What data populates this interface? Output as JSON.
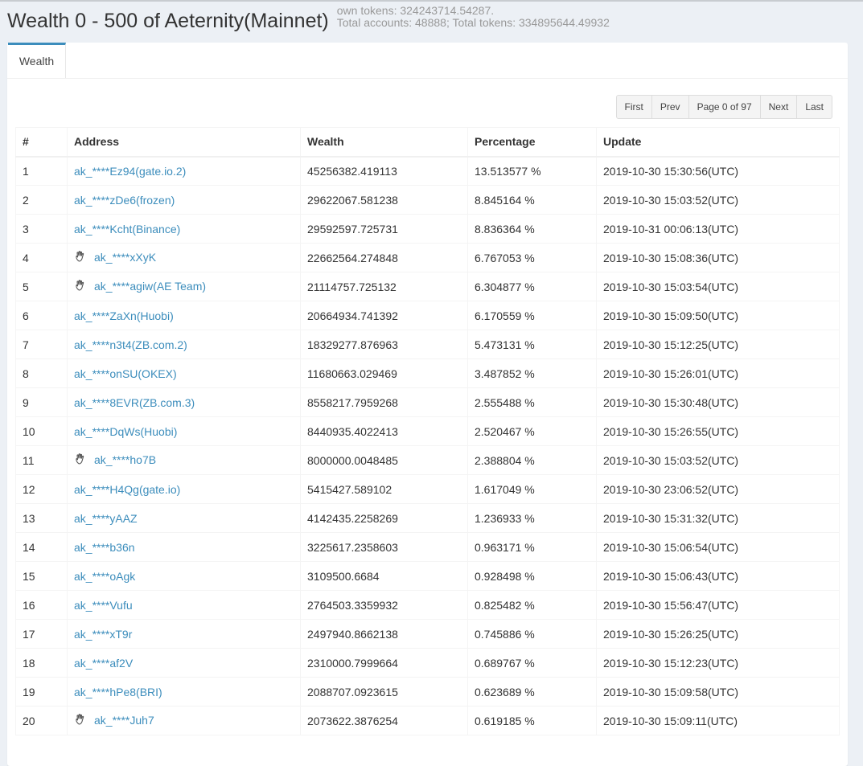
{
  "header": {
    "title": "Wealth 0 - 500 of Aeternity(Mainnet)",
    "own_tokens": "own tokens: 324243714.54287.",
    "totals": "Total accounts: 48888; Total tokens: 334895644.49932"
  },
  "tab": {
    "label": "Wealth"
  },
  "pager": {
    "first": "First",
    "prev": "Prev",
    "info": "Page 0 of 97",
    "next": "Next",
    "last": "Last"
  },
  "columns": [
    "#",
    "Address",
    "Wealth",
    "Percentage",
    "Update"
  ],
  "rows": [
    {
      "n": "1",
      "addr": "ak_****Ez94(gate.io.2)",
      "wealth": "45256382.419113",
      "pct": "13.513577 %",
      "update": "2019-10-30 15:30:56(UTC)",
      "hand": false
    },
    {
      "n": "2",
      "addr": "ak_****zDe6(frozen)",
      "wealth": "29622067.581238",
      "pct": "8.845164 %",
      "update": "2019-10-30 15:03:52(UTC)",
      "hand": false
    },
    {
      "n": "3",
      "addr": "ak_****Kcht(Binance)",
      "wealth": "29592597.725731",
      "pct": "8.836364 %",
      "update": "2019-10-31 00:06:13(UTC)",
      "hand": false
    },
    {
      "n": "4",
      "addr": "ak_****xXyK",
      "wealth": "22662564.274848",
      "pct": "6.767053 %",
      "update": "2019-10-30 15:08:36(UTC)",
      "hand": true
    },
    {
      "n": "5",
      "addr": "ak_****agiw(AE Team)",
      "wealth": "21114757.725132",
      "pct": "6.304877 %",
      "update": "2019-10-30 15:03:54(UTC)",
      "hand": true
    },
    {
      "n": "6",
      "addr": "ak_****ZaXn(Huobi)",
      "wealth": "20664934.741392",
      "pct": "6.170559 %",
      "update": "2019-10-30 15:09:50(UTC)",
      "hand": false
    },
    {
      "n": "7",
      "addr": "ak_****n3t4(ZB.com.2)",
      "wealth": "18329277.876963",
      "pct": "5.473131 %",
      "update": "2019-10-30 15:12:25(UTC)",
      "hand": false
    },
    {
      "n": "8",
      "addr": "ak_****onSU(OKEX)",
      "wealth": "11680663.029469",
      "pct": "3.487852 %",
      "update": "2019-10-30 15:26:01(UTC)",
      "hand": false
    },
    {
      "n": "9",
      "addr": "ak_****8EVR(ZB.com.3)",
      "wealth": "8558217.7959268",
      "pct": "2.555488 %",
      "update": "2019-10-30 15:30:48(UTC)",
      "hand": false
    },
    {
      "n": "10",
      "addr": "ak_****DqWs(Huobi)",
      "wealth": "8440935.4022413",
      "pct": "2.520467 %",
      "update": "2019-10-30 15:26:55(UTC)",
      "hand": false
    },
    {
      "n": "11",
      "addr": "ak_****ho7B",
      "wealth": "8000000.0048485",
      "pct": "2.388804 %",
      "update": "2019-10-30 15:03:52(UTC)",
      "hand": true
    },
    {
      "n": "12",
      "addr": "ak_****H4Qg(gate.io)",
      "wealth": "5415427.589102",
      "pct": "1.617049 %",
      "update": "2019-10-30 23:06:52(UTC)",
      "hand": false
    },
    {
      "n": "13",
      "addr": "ak_****yAAZ",
      "wealth": "4142435.2258269",
      "pct": "1.236933 %",
      "update": "2019-10-30 15:31:32(UTC)",
      "hand": false
    },
    {
      "n": "14",
      "addr": "ak_****b36n",
      "wealth": "3225617.2358603",
      "pct": "0.963171 %",
      "update": "2019-10-30 15:06:54(UTC)",
      "hand": false
    },
    {
      "n": "15",
      "addr": "ak_****oAgk",
      "wealth": "3109500.6684",
      "pct": "0.928498 %",
      "update": "2019-10-30 15:06:43(UTC)",
      "hand": false
    },
    {
      "n": "16",
      "addr": "ak_****Vufu",
      "wealth": "2764503.3359932",
      "pct": "0.825482 %",
      "update": "2019-10-30 15:56:47(UTC)",
      "hand": false
    },
    {
      "n": "17",
      "addr": "ak_****xT9r",
      "wealth": "2497940.8662138",
      "pct": "0.745886 %",
      "update": "2019-10-30 15:26:25(UTC)",
      "hand": false
    },
    {
      "n": "18",
      "addr": "ak_****af2V",
      "wealth": "2310000.7999664",
      "pct": "0.689767 %",
      "update": "2019-10-30 15:12:23(UTC)",
      "hand": false
    },
    {
      "n": "19",
      "addr": "ak_****hPe8(BRI)",
      "wealth": "2088707.0923615",
      "pct": "0.623689 %",
      "update": "2019-10-30 15:09:58(UTC)",
      "hand": false
    },
    {
      "n": "20",
      "addr": "ak_****Juh7",
      "wealth": "2073622.3876254",
      "pct": "0.619185 %",
      "update": "2019-10-30 15:09:11(UTC)",
      "hand": true
    }
  ],
  "colors": {
    "link": "#3c8dbc",
    "tab_accent": "#3c8dbc",
    "background": "#ecf0f5"
  },
  "icons": {
    "hand": "hand-icon"
  }
}
